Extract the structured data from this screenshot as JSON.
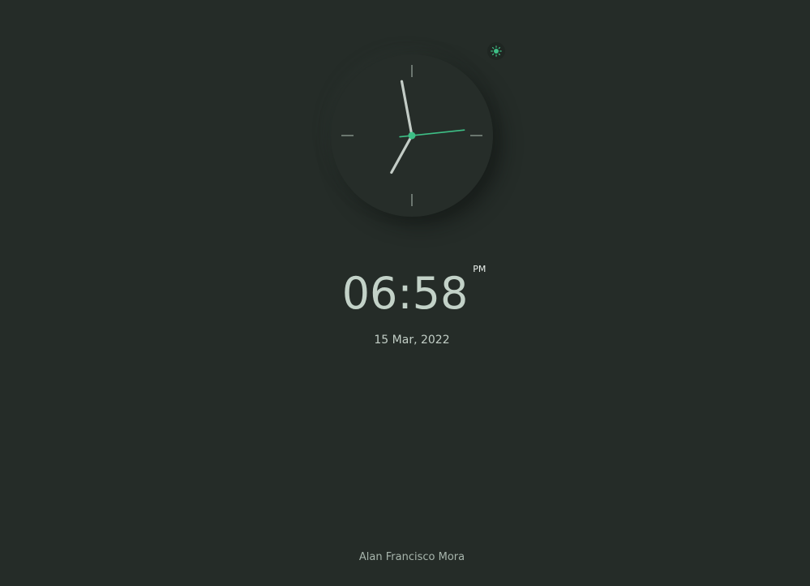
{
  "theme_toggle": {
    "icon": "sun-icon"
  },
  "analog_clock": {
    "hour": 6,
    "minute": 58,
    "second": 14
  },
  "digital_clock": {
    "time": "06:58",
    "period": "PM",
    "date": "15 Mar, 2022"
  },
  "footer": {
    "author": "Alan Francisco Mora"
  },
  "colors": {
    "background": "#252c28",
    "accent": "#3ebf86",
    "text": "#c3d2c8"
  }
}
